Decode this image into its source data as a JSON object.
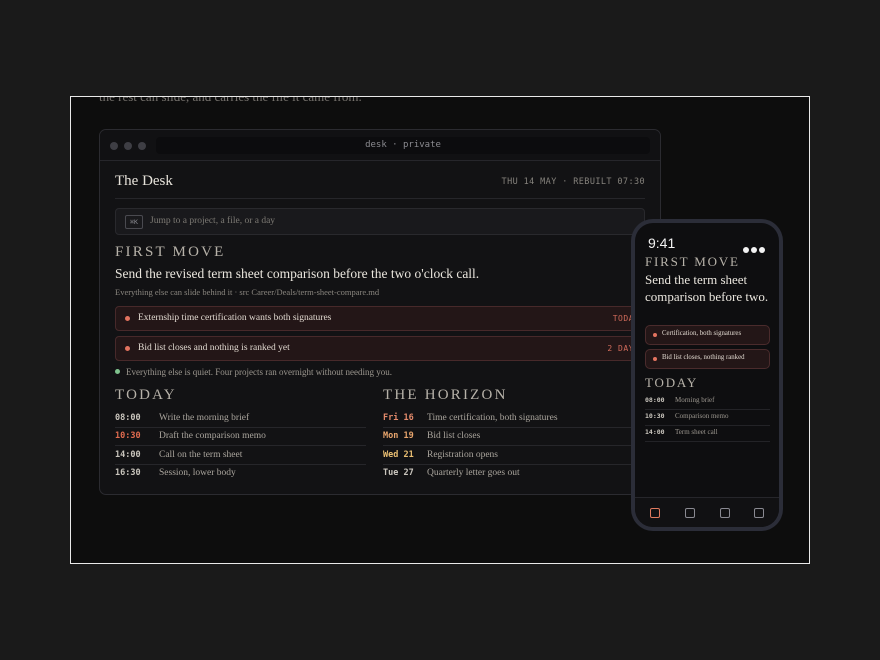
{
  "intro_text": "the rest can slide, and carries the file it came from.",
  "desk": {
    "address": "desk · private",
    "title": "The Desk",
    "date": "THU 14 MAY · REBUILT 07:30",
    "search": {
      "kbd": "⌘K",
      "placeholder": "Jump to a project, a file, or a day"
    },
    "first_move": {
      "label": "FIRST MOVE",
      "headline": "Send the revised term sheet comparison before the two o'clock call.",
      "sub": "Everything else can slide behind it · src Career/Deals/term-sheet-compare.md"
    },
    "alerts": [
      {
        "text": "Externship time certification wants both signatures",
        "tag": "TODA"
      },
      {
        "text": "Bid list closes and nothing is ranked yet",
        "tag": "2 DAY"
      }
    ],
    "quiet": "Everything else is quiet. Four projects ran overnight without needing you.",
    "today": {
      "label": "TODAY",
      "items": [
        {
          "time": "08:00",
          "label": "Write the morning brief"
        },
        {
          "time": "10:30",
          "label": "Draft the comparison memo"
        },
        {
          "time": "14:00",
          "label": "Call on the term sheet"
        },
        {
          "time": "16:30",
          "label": "Session, lower body"
        }
      ]
    },
    "horizon": {
      "label": "THE HORIZON",
      "items": [
        {
          "day": "Fri 16",
          "label": "Time certification, both signatures"
        },
        {
          "day": "Mon 19",
          "label": "Bid list closes"
        },
        {
          "day": "Wed 21",
          "label": "Registration opens"
        },
        {
          "day": "Tue 27",
          "label": "Quarterly letter goes out"
        }
      ]
    }
  },
  "phone": {
    "time": "9:41",
    "first_move_label": "FIRST MOVE",
    "headline": "Send the term sheet comparison before two.",
    "alerts": [
      "Certification, both signatures",
      "Bid list closes, nothing ranked"
    ],
    "today_label": "TODAY",
    "items": [
      {
        "time": "08:00",
        "label": "Morning brief"
      },
      {
        "time": "10:30",
        "label": "Comparison memo"
      },
      {
        "time": "14:00",
        "label": "Term sheet call"
      }
    ],
    "tabs": [
      "home-tab-icon",
      "projects-tab-icon",
      "calendar-tab-icon",
      "settings-tab-icon"
    ]
  },
  "colors": {
    "accent": "#e07a5f",
    "alert_red": "#e3735f",
    "highlight_time": "#e06b4f",
    "horizon_fri": "#e58b6c",
    "horizon_mon": "#e8a56d",
    "horizon_wed": "#e9be72",
    "quiet_green": "#7fc28e"
  }
}
